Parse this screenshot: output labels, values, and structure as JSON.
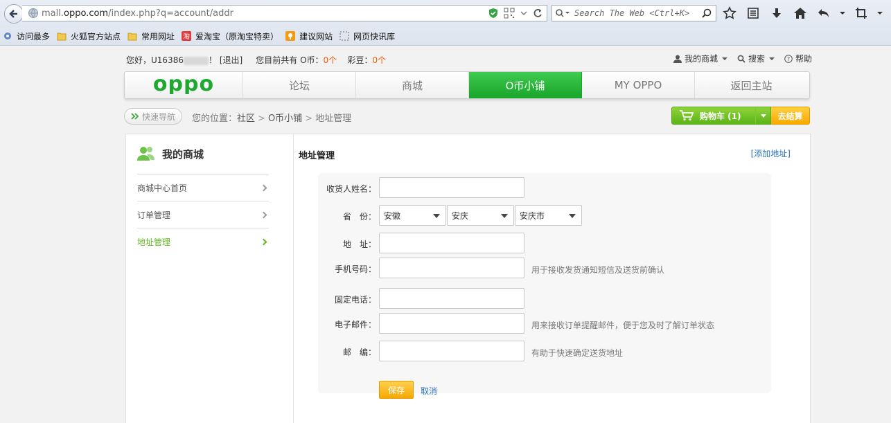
{
  "browser": {
    "url_prefix": "mall.",
    "url_domain": "oppo.com",
    "url_path": "/index.php?q=account/addr",
    "search_placeholder": "Search The Web <Ctrl+K>",
    "bookmarks": [
      {
        "label": "访问最多",
        "icon": "gear-icon"
      },
      {
        "label": "火狐官方站点",
        "icon": "folder-icon"
      },
      {
        "label": "常用网址",
        "icon": "folder-icon"
      },
      {
        "label": "爱淘宝（原淘宝特卖）",
        "icon": "taobao-icon"
      },
      {
        "label": "建议网站",
        "icon": "bulb-icon"
      },
      {
        "label": "网页快讯库",
        "icon": "dotted-box-icon"
      }
    ]
  },
  "userbar": {
    "greeting": "您好，U16386",
    "greeting_end": "！",
    "logout": "[退出]",
    "coins_prefix": "您目前共有 O币：",
    "coins_value": "0个",
    "beans_prefix": "彩豆：",
    "beans_value": "0个",
    "my_mall": "我的商城",
    "search": "搜索",
    "help": "帮助"
  },
  "nav": {
    "logo": "oppo",
    "items": [
      "论坛",
      "商城",
      "O币小铺",
      "MY OPPO",
      "返回主站"
    ],
    "active_index": 2
  },
  "crumb": {
    "quick_nav": "快速导航",
    "prefix": "您的位置：",
    "items": [
      "社区",
      "O币小铺",
      "地址管理"
    ]
  },
  "cart": {
    "label": "购物车 (1)",
    "checkout": "去结算"
  },
  "sidebar": {
    "title": "我的商城",
    "items": [
      "商城中心首页",
      "订单管理",
      "地址管理"
    ],
    "active_index": 2
  },
  "main": {
    "title": "地址管理",
    "add_link": "[添加地址]"
  },
  "form": {
    "name_label": "收货人姓名：",
    "province_label": "省　份：",
    "province_value": "安徽",
    "city_value": "安庆",
    "district_value": "安庆市",
    "address_label": "地　址：",
    "mobile_label": "手机号码：",
    "mobile_hint": "用于接收发货通知短信及送货前确认",
    "phone_label": "固定电话：",
    "email_label": "电子邮件：",
    "email_hint": "用来接收订单提醒邮件，便于您及时了解订单状态",
    "zip_label": "邮　编：",
    "zip_hint": "有助于快速确定送货地址",
    "save": "保存",
    "cancel": "取消"
  },
  "colors": {
    "brand_green": "#1fa82f",
    "accent_orange": "#f25c05",
    "link_blue": "#2a73b8"
  }
}
